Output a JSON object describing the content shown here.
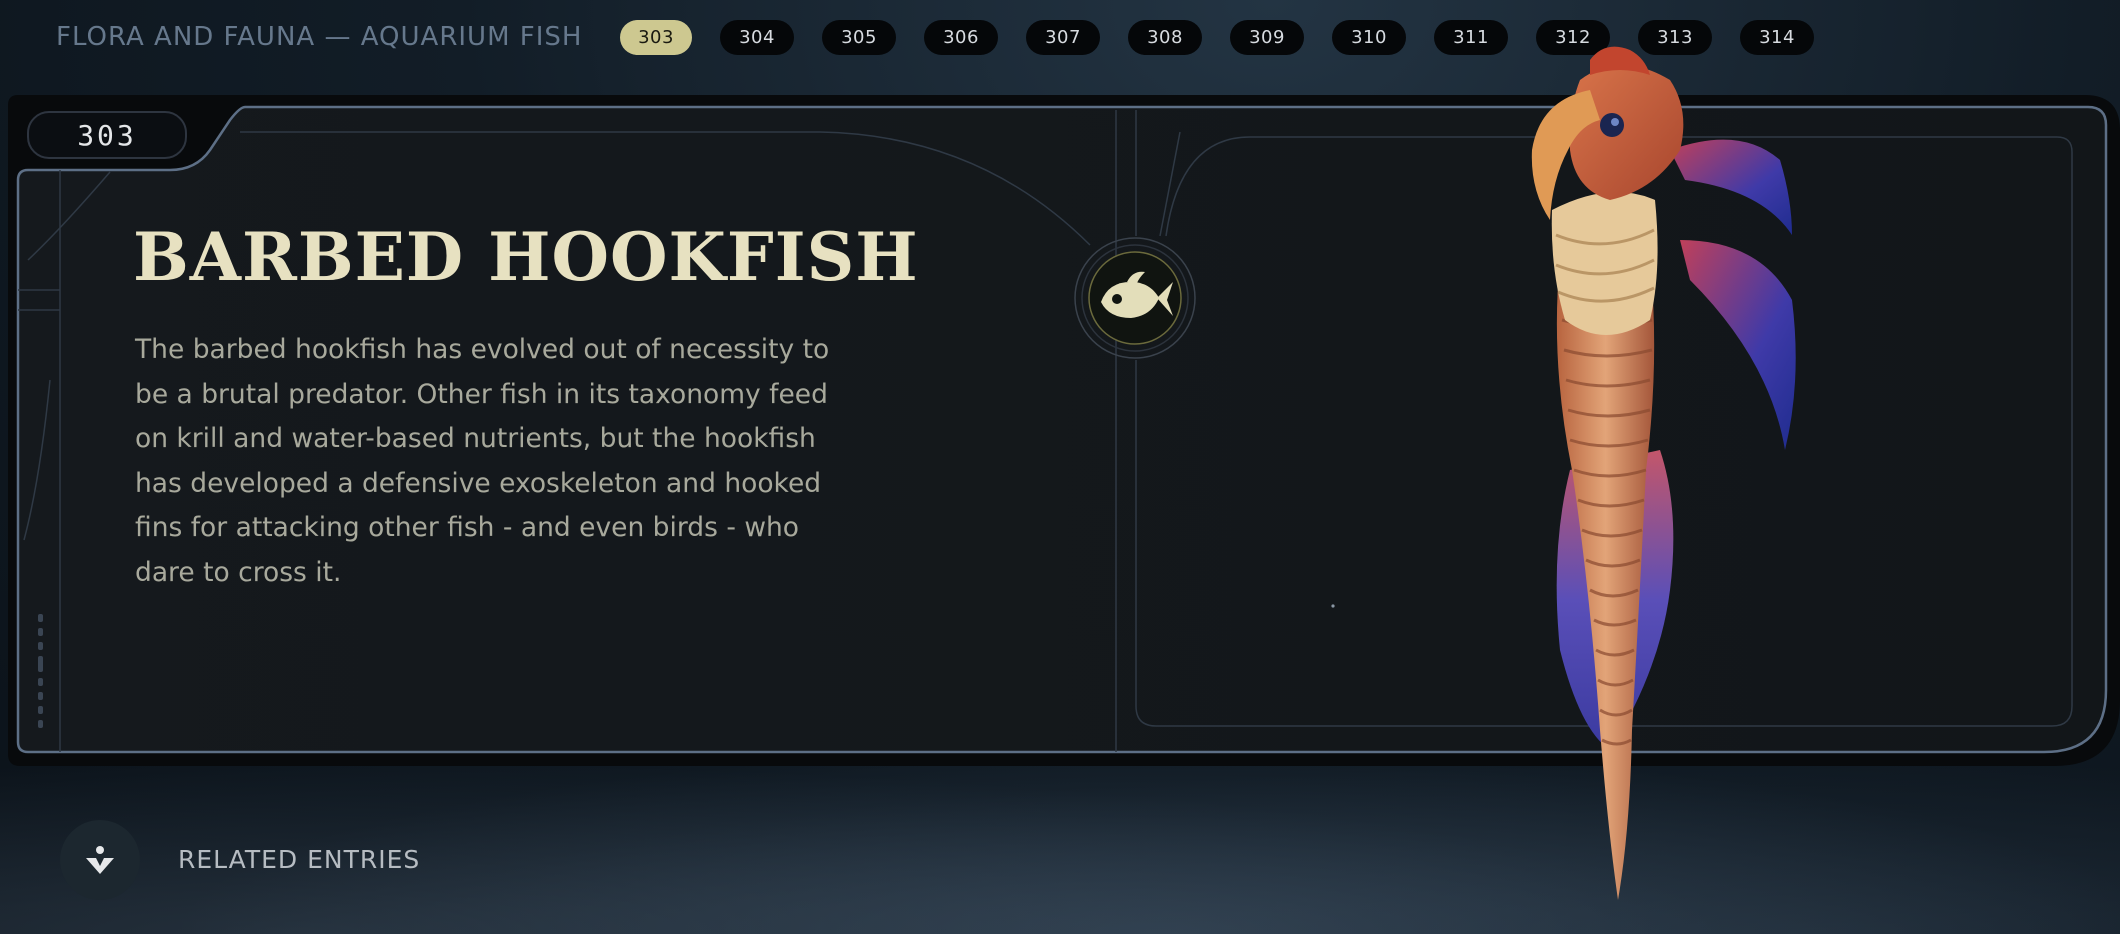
{
  "header": {
    "section_title": "FLORA AND FAUNA — AQUARIUM FISH",
    "tabs": [
      "303",
      "304",
      "305",
      "306",
      "307",
      "308",
      "309",
      "310",
      "311",
      "312",
      "313",
      "314"
    ],
    "active_tab": "303"
  },
  "entry": {
    "number": "303",
    "title": "BARBED HOOKFISH",
    "description": "The barbed hookfish has evolved out of necessity to be a brutal predator. Other fish in its taxonomy feed on krill and water-based nutrients, but the hookfish has developed a defensive exoskeleton and hooked fins for attacking other fish - and even birds - who dare to cross it.",
    "category_icon": "fish-icon",
    "creature_image": "barbed-hookfish-render"
  },
  "footer": {
    "related_label": "RELATED ENTRIES",
    "related_icon": "related-entries-icon"
  },
  "colors": {
    "accent": "#cdc890",
    "title": "#e7e1c1",
    "panel": "#121619",
    "frame": "#5d6f86"
  }
}
